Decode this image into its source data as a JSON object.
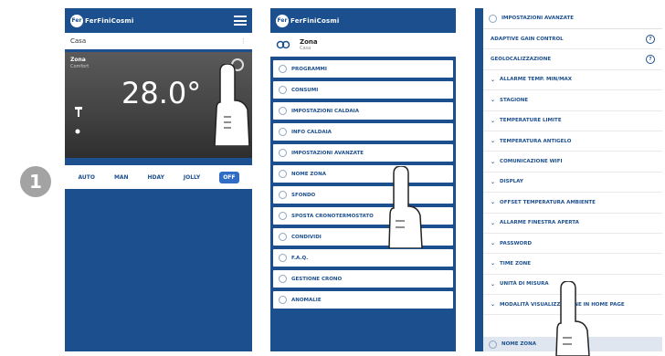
{
  "step": "1",
  "phone1": {
    "brand": "FerFiniCosmi",
    "home_name": "Casa",
    "zone_name": "Zona",
    "zone_status": "Comfort",
    "temperature": "28.0°",
    "modes": [
      "AUTO",
      "MAN",
      "HDAY",
      "JOLLY",
      "OFF"
    ],
    "active_mode": "OFF"
  },
  "phone2": {
    "brand": "FerFiniCosmi",
    "zone_title": "Zona",
    "zone_subtitle": "Casa",
    "menu": [
      "PROGRAMMI",
      "CONSUMI",
      "IMPOSTAZIONI CALDAIA",
      "INFO CALDAIA",
      "IMPOSTAZIONI AVANZATE",
      "NOME ZONA",
      "SFONDO",
      "SPOSTA CRONOTERMOSTATO",
      "CONDIVIDI",
      "F.A.Q.",
      "GESTIONE CRONO",
      "ANOMALIE"
    ]
  },
  "phone3": {
    "section_title": "IMPOSTAZIONI AVANZATE",
    "items": [
      {
        "label": "ADAPTIVE GAIN CONTROL",
        "value": "",
        "kind": "info"
      },
      {
        "label": "GEOLOCALIZZAZIONE",
        "value": "",
        "kind": "info"
      },
      {
        "label": "ALLARME TEMP. MIN/MAX",
        "value": "",
        "kind": "chevron"
      },
      {
        "label": "STAGIONE",
        "value": "",
        "kind": "chevron"
      },
      {
        "label": "TEMPERATURE LIMITE",
        "value": "",
        "kind": "chevron"
      },
      {
        "label": "TEMPERATURA ANTIGELO",
        "value": "",
        "kind": "chevron"
      },
      {
        "label": "COMUNICAZIONE WIFI",
        "value": "",
        "kind": "chevron"
      },
      {
        "label": "DISPLAY",
        "value": "",
        "kind": "chevron"
      },
      {
        "label": "OFFSET TEMPERATURA AMBIENTE",
        "value": "",
        "kind": "chevron"
      },
      {
        "label": "ALLARME FINESTRA APERTA",
        "value": "",
        "kind": "chevron"
      },
      {
        "label": "PASSWORD",
        "value": "",
        "kind": "chevron"
      },
      {
        "label": "TIME ZONE",
        "value": "",
        "kind": "chevron"
      },
      {
        "label": "UNITÀ DI MISURA",
        "value": "",
        "kind": "chevron"
      },
      {
        "label": "MODALITÀ VISUALIZZAZIONE IN HOME PAGE",
        "value": "",
        "kind": "chevron"
      }
    ],
    "footer_item": "NOME ZONA"
  }
}
